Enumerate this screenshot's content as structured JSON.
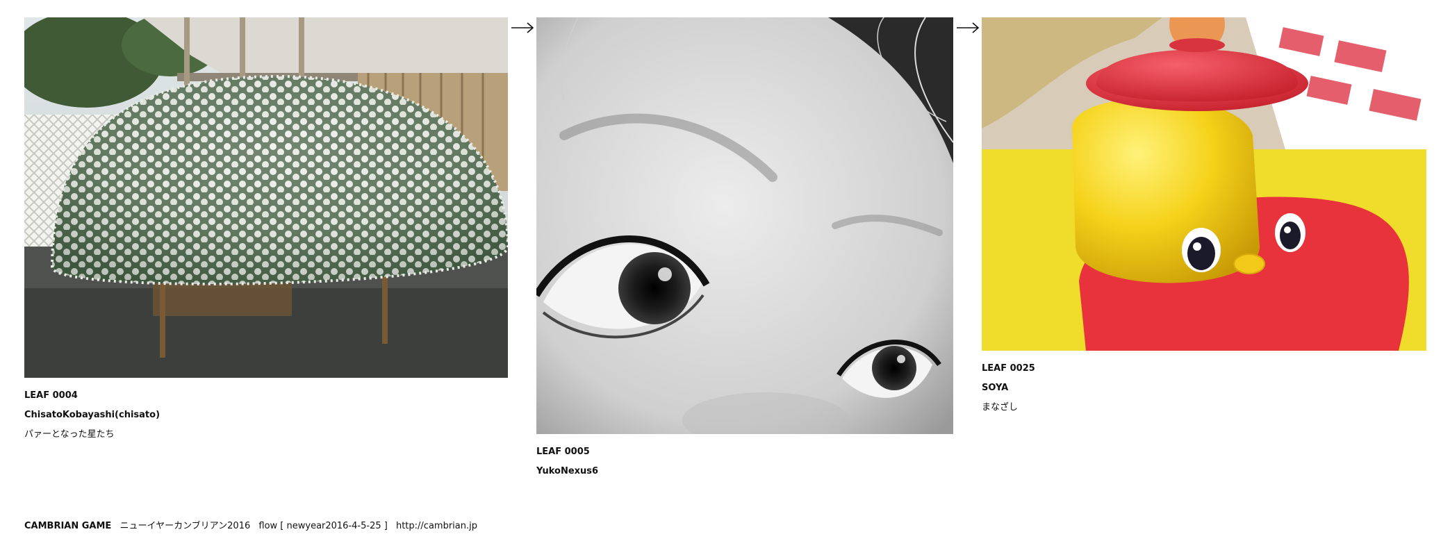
{
  "leaves": [
    {
      "id": "LEAF 0004",
      "author": "ChisatoKobayashi(chisato)",
      "title": "パァーとなった星たち",
      "image": "chrysanthemum-dome-photo"
    },
    {
      "id": "LEAF 0005",
      "author": "YukoNexus6",
      "title": "",
      "image": "monochrome-eyes-photo"
    },
    {
      "id": "LEAF 0025",
      "author": "SOYA",
      "title": "まなざし",
      "image": "yellow-toy-photo"
    }
  ],
  "arrow_icon": "right-arrow-icon",
  "footer": {
    "brand": "CAMBRIAN GAME",
    "event": "ニューイヤーカンブリアン2016",
    "flow": "flow [ newyear2016-4-5-25 ]",
    "url": "http://cambrian.jp"
  },
  "colors": {
    "background": "#ffffff",
    "text": "#111111",
    "toy_red": "#e8323c",
    "toy_yellow": "#f3d21c"
  }
}
